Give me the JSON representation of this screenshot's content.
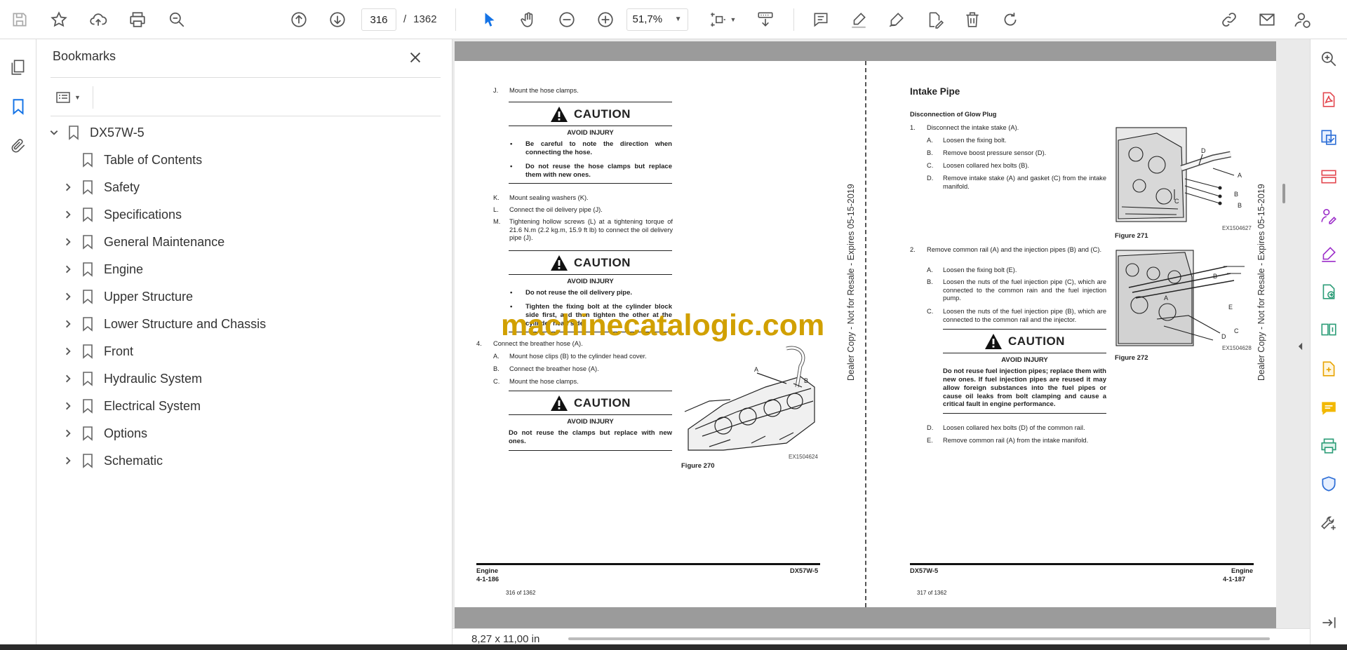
{
  "toolbar": {
    "page_current": "316",
    "page_separator": "/",
    "page_total": "1362",
    "zoom": "51,7%"
  },
  "bookmarks": {
    "title": "Bookmarks",
    "items": [
      {
        "label": "DX57W-5",
        "level": 0,
        "expanded": true
      },
      {
        "label": "Table of Contents",
        "level": 1,
        "has_children": false
      },
      {
        "label": "Safety",
        "level": 1,
        "has_children": true
      },
      {
        "label": "Specifications",
        "level": 1,
        "has_children": true
      },
      {
        "label": "General Maintenance",
        "level": 1,
        "has_children": true
      },
      {
        "label": "Engine",
        "level": 1,
        "has_children": true
      },
      {
        "label": "Upper Structure",
        "level": 1,
        "has_children": true
      },
      {
        "label": "Lower Structure and Chassis",
        "level": 1,
        "has_children": true
      },
      {
        "label": "Front",
        "level": 1,
        "has_children": true
      },
      {
        "label": "Hydraulic System",
        "level": 1,
        "has_children": true
      },
      {
        "label": "Electrical System",
        "level": 1,
        "has_children": true
      },
      {
        "label": "Options",
        "level": 1,
        "has_children": true
      },
      {
        "label": "Schematic",
        "level": 1,
        "has_children": true
      }
    ]
  },
  "watermark": "machinecatalogic.com",
  "vertical_note": "Dealer Copy - Not for Resale - Expires 05-15-2019",
  "left_page": {
    "j_letter": "J.",
    "j_text": "Mount the hose clamps.",
    "caution_word": "CAUTION",
    "avoid": "AVOID INJURY",
    "c1_b1": "Be careful to note the direction when connecting the hose.",
    "c1_b2": "Do not reuse the hose clamps but replace them with new ones.",
    "k_letter": "K.",
    "k_text": "Mount sealing washers (K).",
    "l_letter": "L.",
    "l_text": "Connect the oil delivery pipe (J).",
    "m_letter": "M.",
    "m_text": "Tightening hollow screws (L) at a tightening torque of 21.6 N.m (2.2 kg.m, 15.9 ft lb) to connect the oil delivery pipe (J).",
    "c2_b1": "Do not reuse the oil delivery pipe.",
    "c2_b2": "Tighten the fixing bolt at the cylinder block side first, and then tighten the other at the cylinder head side.",
    "s4_num": "4.",
    "s4_text": "Connect the breather hose (A).",
    "s4a_letter": "A.",
    "s4a_text": "Mount hose clips (B) to the cylinder head cover.",
    "s4b_letter": "B.",
    "s4b_text": "Connect the breather hose (A).",
    "s4c_letter": "C.",
    "s4c_text": "Mount the hose clamps.",
    "c3_text": "Do not reuse the clamps but replace with new ones.",
    "fig_label_a": "A",
    "fig_label_b": "B",
    "fig_id": "EX1504624",
    "fig_caption": "Figure 270",
    "footer_section": "Engine",
    "footer_page": "4-1-186",
    "footer_model": "DX57W-5",
    "page_of": "316 of 1362"
  },
  "right_page": {
    "title": "Intake Pipe",
    "subtitle": "Disconnection of Glow Plug",
    "s1_num": "1.",
    "s1_text": "Disconnect the intake stake (A).",
    "s1a_letter": "A.",
    "s1a_text": "Loosen the fixing bolt.",
    "s1b_letter": "B.",
    "s1b_text": "Remove boost pressure sensor (D).",
    "s1c_letter": "C.",
    "s1c_text": "Loosen collared hex bolts (B).",
    "s1d_letter": "D.",
    "s1d_text": "Remove intake stake (A) and gasket (C) from the intake manifold.",
    "fig271_id": "EX1504627",
    "fig271_caption": "Figure 271",
    "f271_d": "D",
    "f271_a": "A",
    "f271_b1": "B",
    "f271_b2": "B",
    "f271_c": "C",
    "s2_num": "2.",
    "s2_text": "Remove common rail (A) and the injection pipes (B) and (C).",
    "s2a_letter": "A.",
    "s2a_text": "Loosen the fixing bolt (E).",
    "s2b_letter": "B.",
    "s2b_text": "Loosen the nuts of the fuel injection pipe (C), which are connected to the common rain and the fuel injection pump.",
    "s2c_letter": "C.",
    "s2c_text": "Loosen the nuts of the fuel injection pipe (B), which are connected to the common rail and the injector.",
    "caution_word": "CAUTION",
    "avoid": "AVOID INJURY",
    "c_text": "Do not reuse fuel injection pipes; replace them with new ones. If fuel injection pipes are reused it may allow foreign substances into the fuel pipes or cause oil leaks from bolt clamping and cause a critical fault in engine performance.",
    "s2d_letter": "D.",
    "s2d_text": "Loosen collared hex bolts (D) of the common rail.",
    "s2e_letter": "E.",
    "s2e_text": "Remove common rail (A) from the intake manifold.",
    "fig272_id": "EX1504628",
    "fig272_caption": "Figure 272",
    "f272_b": "B",
    "f272_a": "A",
    "f272_e": "E",
    "f272_c": "C",
    "f272_d": "D",
    "footer_model": "DX57W-5",
    "footer_section": "Engine",
    "footer_page": "4-1-187",
    "page_of": "317 of 1362"
  },
  "status": {
    "page_size": "8,27 x 11,00 in"
  }
}
